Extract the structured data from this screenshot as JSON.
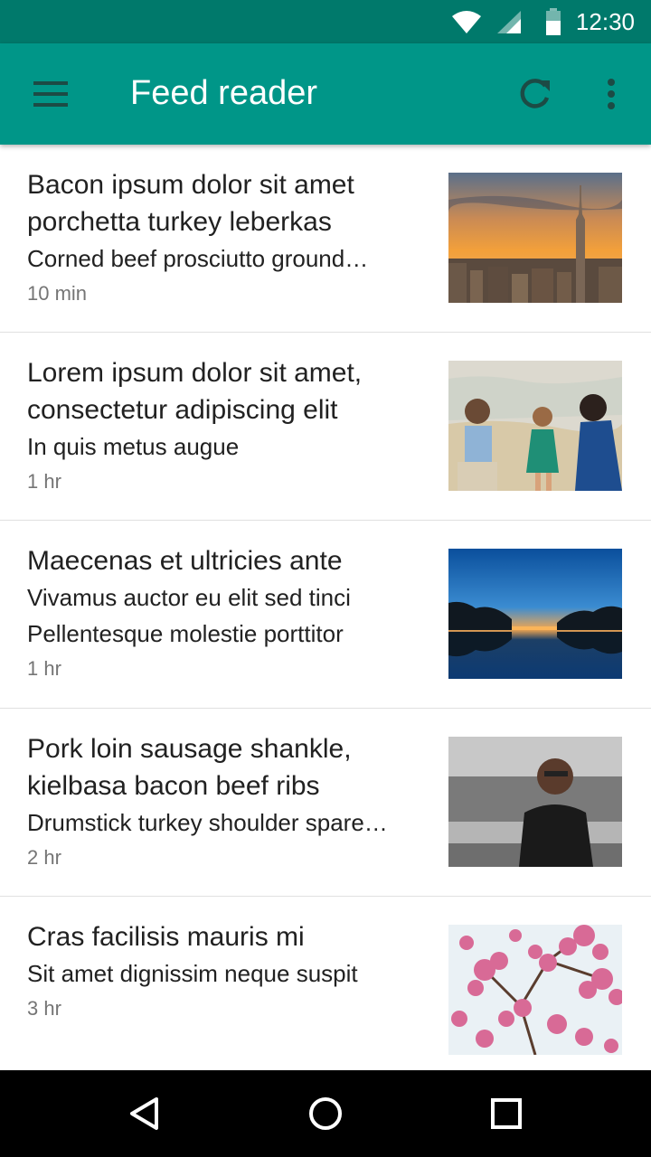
{
  "status": {
    "time": "12:30",
    "icons": [
      "wifi-icon",
      "signal-icon",
      "battery-icon"
    ]
  },
  "appbar": {
    "title": "Feed reader",
    "icons": [
      "menu-icon",
      "refresh-icon",
      "more-vert-icon"
    ],
    "color": "#009688",
    "status_color": "#00796b"
  },
  "items": [
    {
      "title": "Bacon ipsum dolor sit amet porchetta turkey leberkas",
      "snippet": "Corned beef prosciutto ground…",
      "snippet2": "",
      "time": "10 min",
      "thumb": "city-skyline-sunset"
    },
    {
      "title": "Lorem ipsum dolor sit amet, consectetur adipiscing elit",
      "snippet": "In quis metus augue",
      "snippet2": "",
      "time": "1 hr",
      "thumb": "family-beach"
    },
    {
      "title": "Maecenas et ultricies ante",
      "snippet": "Vivamus auctor eu elit sed tinci",
      "snippet2": "Pellentesque molestie porttitor",
      "time": "1 hr",
      "thumb": "palm-trees-reflection"
    },
    {
      "title": "Pork loin sausage shankle, kielbasa bacon beef ribs",
      "snippet": "Drumstick turkey shoulder spare…",
      "snippet2": "",
      "time": "2 hr",
      "thumb": "chef-kitchen"
    },
    {
      "title": "Cras facilisis mauris mi",
      "snippet": "Sit amet dignissim neque suspit",
      "snippet2": "",
      "time": "3 hr",
      "thumb": "pink-blossoms"
    }
  ],
  "navbar": {
    "icons": [
      "back-icon",
      "home-icon",
      "recents-icon"
    ]
  }
}
